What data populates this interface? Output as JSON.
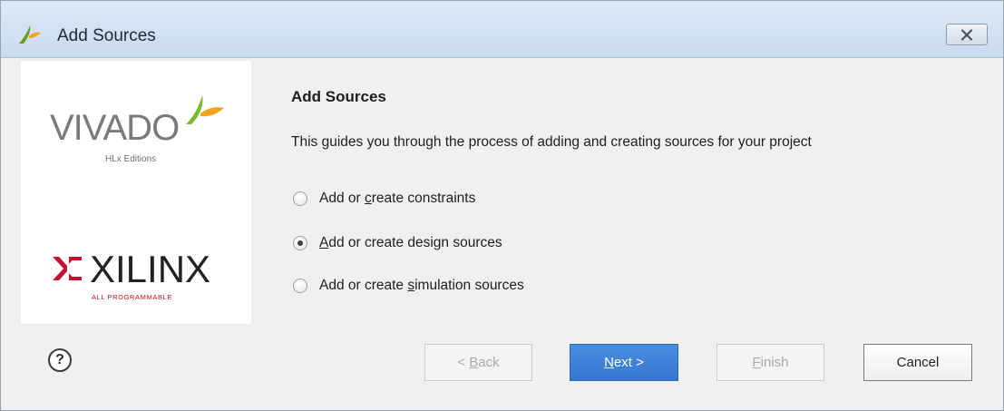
{
  "window": {
    "title": "Add Sources",
    "close_icon": "close-icon"
  },
  "branding": {
    "product": "VIVADO",
    "product_sub": "HLx Editions",
    "company": "XILINX",
    "company_tag": "ALL PROGRAMMABLE"
  },
  "content": {
    "title": "Add Sources",
    "description": "This guides you through the process of adding and creating sources for your project",
    "options": [
      {
        "pre": "Add or ",
        "mn": "c",
        "post": "reate constraints",
        "checked": false
      },
      {
        "pre": "",
        "mn": "A",
        "post": "dd or create design sources",
        "checked": true
      },
      {
        "pre": "Add or create ",
        "mn": "s",
        "post": "imulation sources",
        "checked": false
      }
    ]
  },
  "footer": {
    "help": "?",
    "back": {
      "pre": "< ",
      "mn": "B",
      "post": "ack"
    },
    "next": {
      "pre": "",
      "mn": "N",
      "post": "ext >"
    },
    "finish": {
      "pre": "",
      "mn": "F",
      "post": "inish"
    },
    "cancel": "Cancel"
  },
  "colors": {
    "accent": "#3577d0",
    "xilinx_red": "#c8102e",
    "vivado_green": "#7fb82e"
  }
}
